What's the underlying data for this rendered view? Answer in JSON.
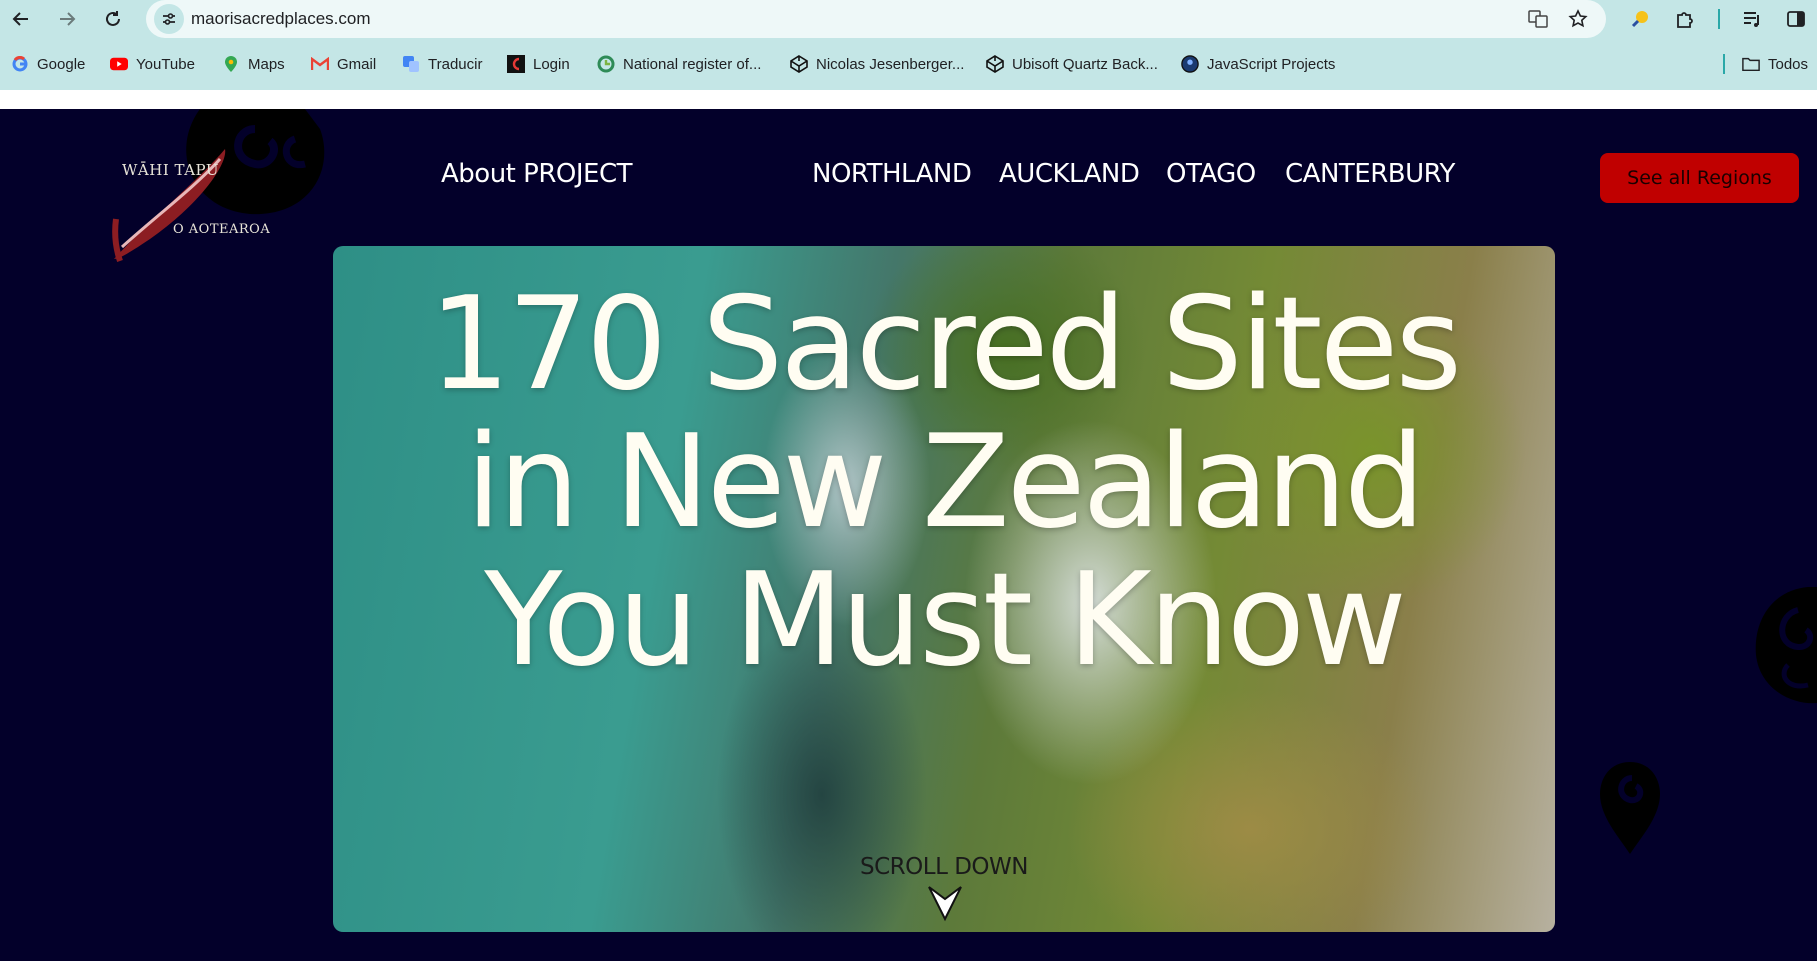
{
  "browser": {
    "url": "maorisacredplaces.com",
    "bookmarks": [
      {
        "label": "Google",
        "icon": "google-icon"
      },
      {
        "label": "YouTube",
        "icon": "youtube-icon"
      },
      {
        "label": "Maps",
        "icon": "maps-icon"
      },
      {
        "label": "Gmail",
        "icon": "gmail-icon"
      },
      {
        "label": "Traducir",
        "icon": "translate-icon"
      },
      {
        "label": "Login",
        "icon": "login-icon"
      },
      {
        "label": "National register of...",
        "icon": "register-icon"
      },
      {
        "label": "Nicolas Jesenberger...",
        "icon": "codepen-icon"
      },
      {
        "label": "Ubisoft Quartz Back...",
        "icon": "codepen-icon"
      },
      {
        "label": "JavaScript Projects",
        "icon": "avatar-icon"
      }
    ],
    "all_bookmarks_label": "Todos"
  },
  "site": {
    "logo": {
      "line1": "WĀHI TAPU",
      "line2": "O AOTEAROA"
    },
    "nav": {
      "about": "About PROJECT",
      "regions": [
        "NORTHLAND",
        "AUCKLAND",
        "OTAGO",
        "CANTERBURY"
      ],
      "cta": "See all Regions"
    },
    "hero": {
      "title_lines": [
        "170 Sacred Sites",
        "in New Zealand",
        "You Must Know"
      ],
      "scroll_label": "SCROLL DOWN"
    }
  },
  "colors": {
    "page_bg": "#03002a",
    "chrome_bg": "#c4e6e6",
    "cta_bg": "#c00000",
    "hero_text": "#fffdf2"
  }
}
